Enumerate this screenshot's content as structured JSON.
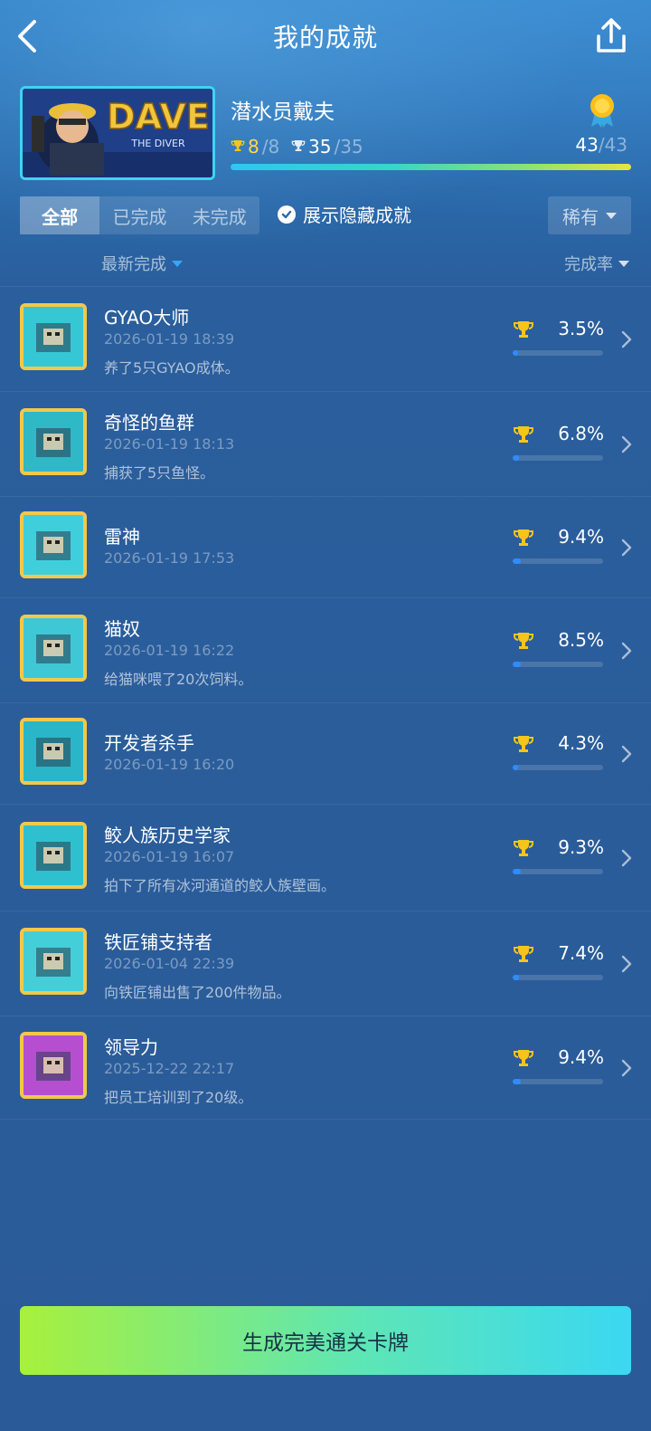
{
  "header": {
    "title": "我的成就"
  },
  "game": {
    "name": "潜水员戴夫",
    "art_title": "DAVE",
    "art_subtitle": "THE DIVER",
    "gold_done": "8",
    "gold_total": "/8",
    "silver_done": "35",
    "silver_total": "/35",
    "all_done": "43",
    "all_total": "/43",
    "progress": 1.0
  },
  "filters": {
    "tabs": [
      "全部",
      "已完成",
      "未完成"
    ],
    "active_tab": 0,
    "show_hidden_label": "展示隐藏成就",
    "show_hidden_checked": true,
    "rarity_label": "稀有"
  },
  "sort": {
    "latest_label": "最新完成",
    "rate_label": "完成率"
  },
  "achievements": [
    {
      "name": "GYAO大师",
      "time": "2026-01-19 18:39",
      "desc": "养了5只GYAO成体。",
      "rate": "3.5%",
      "rate_value": 0.035,
      "icon": "fish-5-icon",
      "frame": "#f2c84a",
      "bg": "#36c7d4"
    },
    {
      "name": "奇怪的鱼群",
      "time": "2026-01-19 18:13",
      "desc": "捕获了5只鱼怪。",
      "rate": "6.8%",
      "rate_value": 0.068,
      "icon": "fish-monster-icon",
      "frame": "#f2c84a",
      "bg": "#2fb8c6"
    },
    {
      "name": "雷神",
      "time": "2026-01-19 17:53",
      "desc": "",
      "rate": "9.4%",
      "rate_value": 0.094,
      "icon": "hammer-icon",
      "frame": "#f2c84a",
      "bg": "#3fcfdc"
    },
    {
      "name": "猫奴",
      "time": "2026-01-19 16:22",
      "desc": "给猫咪喂了20次饲料。",
      "rate": "8.5%",
      "rate_value": 0.085,
      "icon": "cat-icon",
      "frame": "#f2c84a",
      "bg": "#3ec8d6"
    },
    {
      "name": "开发者杀手",
      "time": "2026-01-19 16:20",
      "desc": "",
      "rate": "4.3%",
      "rate_value": 0.043,
      "icon": "developer-icon",
      "frame": "#f2c84a",
      "bg": "#2ab6c8"
    },
    {
      "name": "鲛人族历史学家",
      "time": "2026-01-19 16:07",
      "desc": "拍下了所有冰河通道的鲛人族壁画。",
      "rate": "9.3%",
      "rate_value": 0.093,
      "icon": "mural-icon",
      "frame": "#f2c84a",
      "bg": "#2fc0cf"
    },
    {
      "name": "铁匠铺支持者",
      "time": "2026-01-04 22:39",
      "desc": "向铁匠铺出售了200件物品。",
      "rate": "7.4%",
      "rate_value": 0.074,
      "icon": "blacksmith-icon",
      "frame": "#f2c84a",
      "bg": "#44cfd8"
    },
    {
      "name": "领导力",
      "time": "2025-12-22 22:17",
      "desc": "把员工培训到了20级。",
      "rate": "9.4%",
      "rate_value": 0.094,
      "icon": "leader-20-icon",
      "frame": "#f2c84a",
      "bg": "#b54fd0"
    }
  ],
  "cta": {
    "label": "生成完美通关卡牌"
  }
}
